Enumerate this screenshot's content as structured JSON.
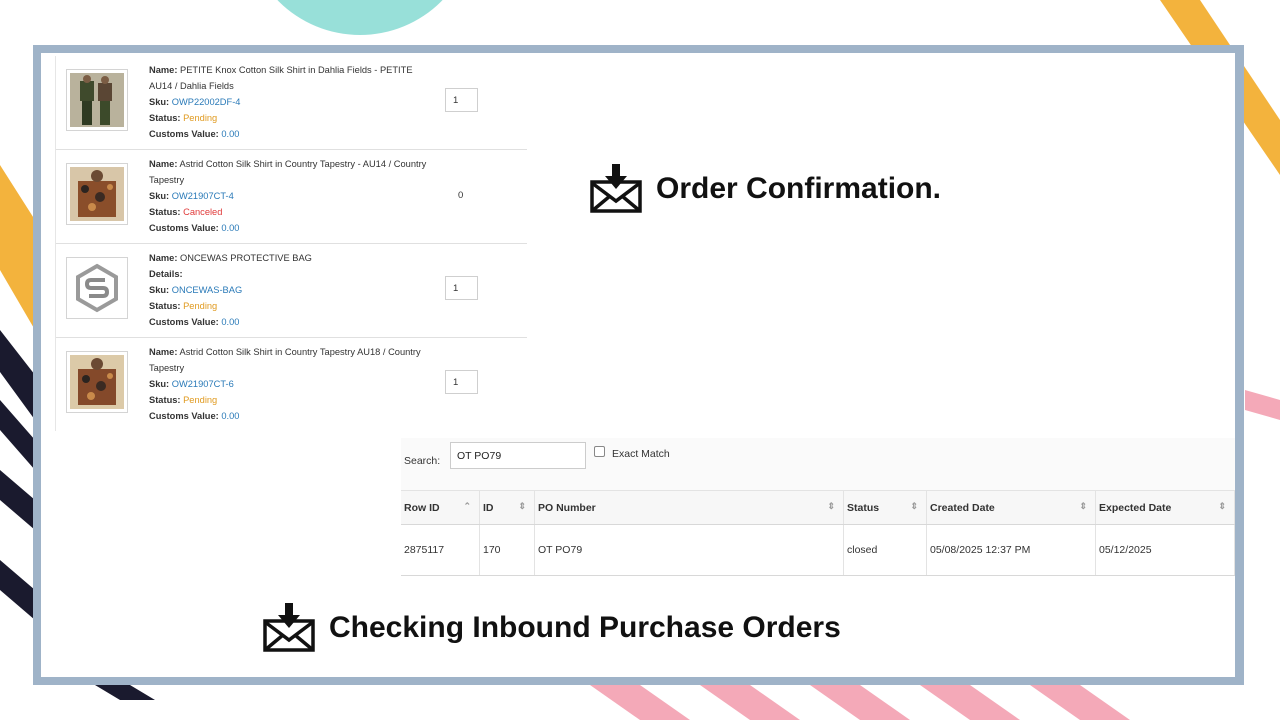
{
  "theme": {
    "frame_color": "#9fb3c8",
    "link_blue": "#2a7ab8",
    "status_pending": "#e09a1f",
    "status_canceled": "#e03a3a"
  },
  "labels": {
    "name": "Name:",
    "details": "Details:",
    "sku": "Sku:",
    "status": "Status:",
    "customs": "Customs Value:"
  },
  "items": [
    {
      "name": "PETITE Knox Cotton Silk Shirt in Dahlia Fields - PETITE AU14 / Dahlia Fields",
      "sku": "OWP22002DF-4",
      "status": "Pending",
      "customs_value": "0.00",
      "qty": "1",
      "thumb_icon": "product-photo"
    },
    {
      "name": "Astrid Cotton Silk Shirt in Country Tapestry - AU14 / Country Tapestry",
      "sku": "OW21907CT-4",
      "status": "Canceled",
      "customs_value": "0.00",
      "qty": "0",
      "thumb_icon": "product-photo"
    },
    {
      "name": "ONCEWAS PROTECTIVE BAG",
      "sku": "ONCEWAS-BAG",
      "status": "Pending",
      "customs_value": "0.00",
      "qty": "1",
      "thumb_icon": "brand-logo"
    },
    {
      "name": "Astrid Cotton Silk Shirt in Country Tapestry AU18 / Country Tapestry",
      "sku": "OW21907CT-6",
      "status": "Pending",
      "customs_value": "0.00",
      "qty": "1",
      "thumb_icon": "product-photo"
    }
  ],
  "headings": {
    "order_confirmation": "Order Confirmation.",
    "checking_inbound": "Checking Inbound Purchase Orders",
    "icon": "mail-download-icon"
  },
  "search": {
    "label": "Search:",
    "value": "OT PO79",
    "exact_match_label": "Exact Match",
    "exact_match_checked": false
  },
  "table": {
    "columns": [
      "Row ID",
      "ID",
      "PO Number",
      "Status",
      "Created Date",
      "Expected Date"
    ],
    "rows": [
      [
        "2875117",
        "170",
        "OT PO79",
        "closed",
        "05/08/2025 12:37 PM",
        "05/12/2025"
      ]
    ]
  }
}
